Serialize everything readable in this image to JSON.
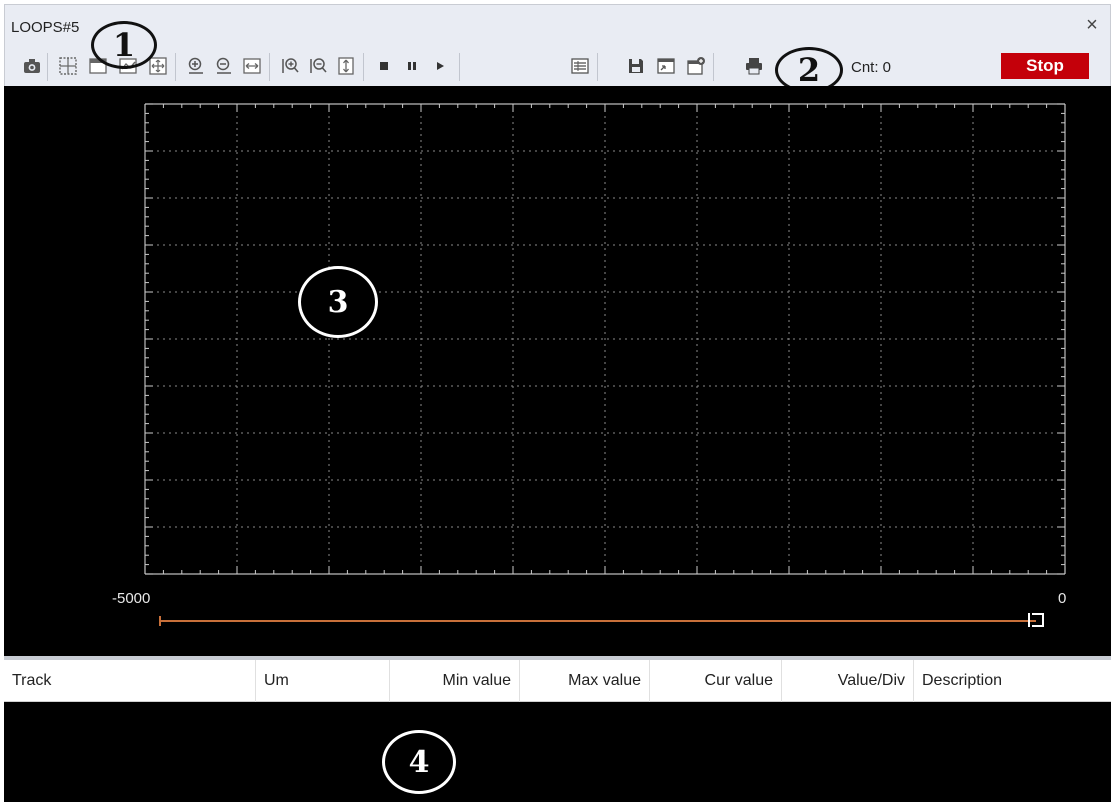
{
  "window": {
    "title": "LOOPS#5",
    "close_glyph": "×"
  },
  "toolbar": {
    "buttons": [
      "camera-icon",
      "grid-icon",
      "chart-icon",
      "check-chart-icon",
      "fit-all-icon",
      "zoom-in-icon",
      "zoom-out-icon",
      "fit-width-icon",
      "zoom-x-in-icon",
      "zoom-x-out-icon",
      "fit-height-icon",
      "stop-icon",
      "pause-icon",
      "play-icon",
      "table-icon",
      "save-icon",
      "export-icon",
      "add-icon",
      "print-icon"
    ],
    "cnt_label": "Cnt: 0",
    "stop_label": "Stop",
    "stop_color": "#c4000a"
  },
  "callouts": {
    "c1": "1",
    "c2": "2",
    "c3": "3",
    "c4": "4"
  },
  "scope": {
    "x_min_label": "-5000",
    "x_max_label": "0",
    "grid_color": "#8a8a8a",
    "slider_color": "#c8703a"
  },
  "table": {
    "headers": [
      "Track",
      "Um",
      "Min value",
      "Max value",
      "Cur value",
      "Value/Div",
      "Description"
    ]
  }
}
